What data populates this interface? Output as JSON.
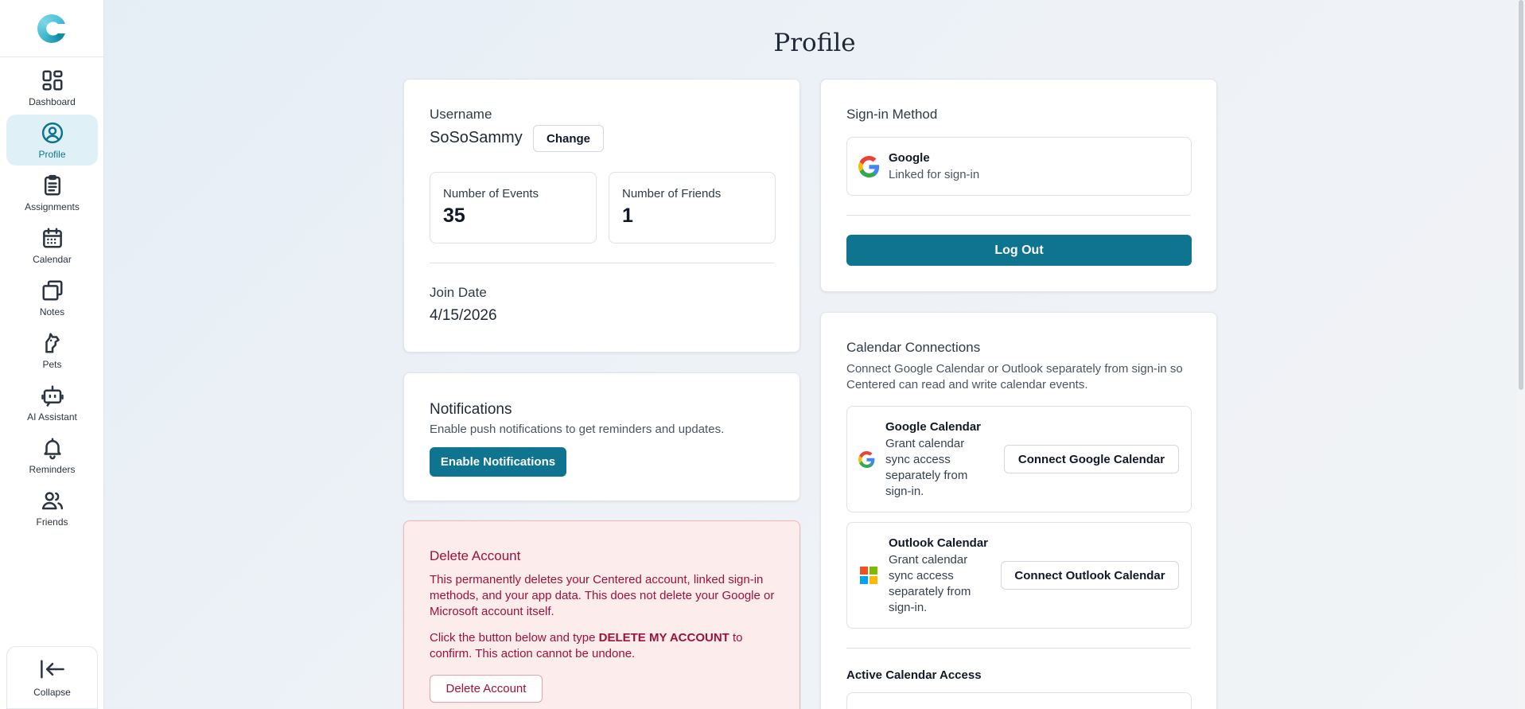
{
  "sidebar": {
    "items": [
      {
        "label": "Dashboard",
        "icon": "dashboard-icon"
      },
      {
        "label": "Profile",
        "icon": "user-circle-icon",
        "active": true
      },
      {
        "label": "Assignments",
        "icon": "clipboard-icon"
      },
      {
        "label": "Calendar",
        "icon": "calendar-icon"
      },
      {
        "label": "Notes",
        "icon": "notes-icon"
      },
      {
        "label": "Pets",
        "icon": "pet-icon"
      },
      {
        "label": "AI Assistant",
        "icon": "bot-icon"
      },
      {
        "label": "Reminders",
        "icon": "bell-icon"
      },
      {
        "label": "Friends",
        "icon": "users-icon"
      }
    ],
    "collapse_label": "Collapse"
  },
  "page": {
    "title": "Profile"
  },
  "profile": {
    "username_label": "Username",
    "username": "SoSoSammy",
    "change_label": "Change",
    "events_label": "Number of Events",
    "events_value": "35",
    "friends_label": "Number of Friends",
    "friends_value": "1",
    "join_label": "Join Date",
    "join_value": "4/15/2026"
  },
  "notifications": {
    "title": "Notifications",
    "description": "Enable push notifications to get reminders and updates.",
    "button": "Enable Notifications"
  },
  "delete_account": {
    "title": "Delete Account",
    "paragraph1": "This permanently deletes your Centered account, linked sign-in methods, and your app data. This does not delete your Google or Microsoft account itself.",
    "p2_before": "Click the button below and type ",
    "p2_bold": "DELETE MY ACCOUNT",
    "p2_after": " to confirm. This action cannot be undone.",
    "button": "Delete Account"
  },
  "signin": {
    "title": "Sign-in Method",
    "provider": "Google",
    "status": "Linked for sign-in",
    "logout": "Log Out"
  },
  "calendar_connections": {
    "title": "Calendar Connections",
    "description": "Connect Google Calendar or Outlook separately from sign-in so Centered can read and write calendar events.",
    "google": {
      "name": "Google Calendar",
      "desc": "Grant calendar sync access separately from sign-in.",
      "button": "Connect Google Calendar"
    },
    "outlook": {
      "name": "Outlook Calendar",
      "desc": "Grant calendar sync access separately from sign-in.",
      "button": "Connect Outlook Calendar"
    },
    "active_title": "Active Calendar Access"
  },
  "colors": {
    "accent": "#0e7490",
    "active_nav_bg": "#dff1f7",
    "danger_text": "#9f1239",
    "danger_bg": "#fdecec",
    "danger_border": "#f5b5b5"
  }
}
